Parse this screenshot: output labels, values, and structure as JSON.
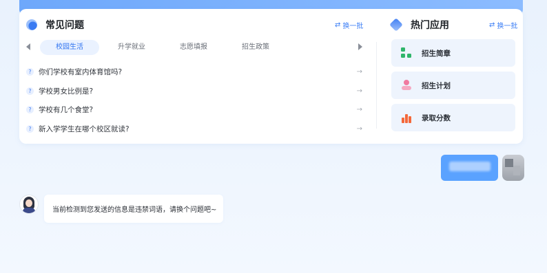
{
  "faq": {
    "title": "常见问题",
    "swap_label": "换一批",
    "tabs": [
      {
        "label": "校园生活",
        "active": true
      },
      {
        "label": "升学就业",
        "active": false
      },
      {
        "label": "志愿填报",
        "active": false
      },
      {
        "label": "招生政策",
        "active": false
      }
    ],
    "questions": [
      "你们学校有室内体育馆吗?",
      "学校男女比例是?",
      "学校有几个食堂?",
      "新入学学生在哪个校区就读?"
    ],
    "question_mark": "?",
    "row_arrow": "→"
  },
  "apps": {
    "title": "热门应用",
    "swap_label": "换一批",
    "items": [
      {
        "label": "招生简章",
        "icon": "grid-icon"
      },
      {
        "label": "招生计划",
        "icon": "person-icon"
      },
      {
        "label": "录取分数",
        "icon": "bar-chart-icon"
      }
    ]
  },
  "chat": {
    "bot_message": "当前检测到您发送的信息是违禁词语，请换个问题吧~"
  },
  "colors": {
    "accent": "#3d7ff5",
    "user_bubble": "#5aa2ff",
    "page_bg": "#eaf3fd"
  },
  "icons": {
    "swap": "⇄"
  }
}
